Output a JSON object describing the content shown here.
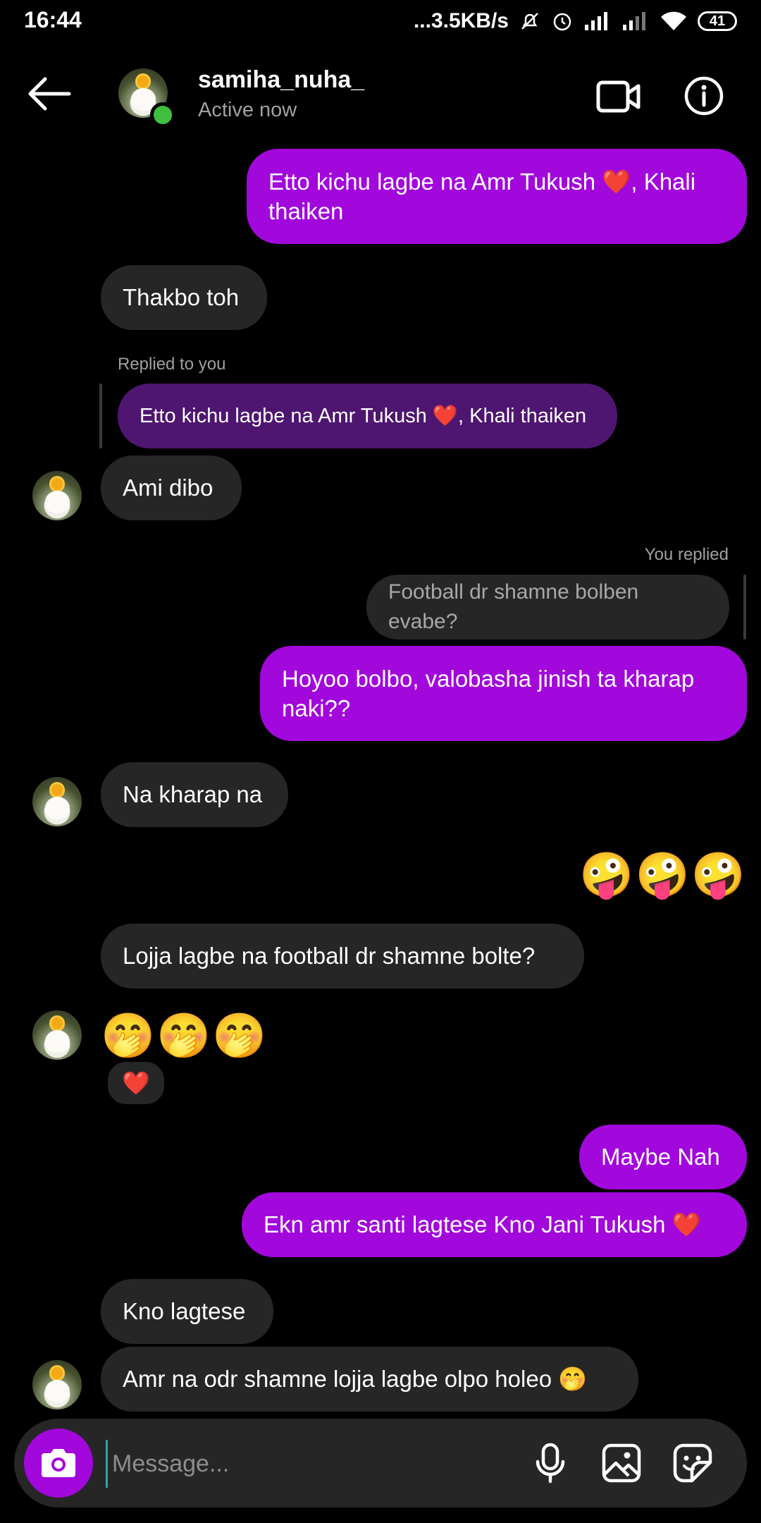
{
  "status_bar": {
    "time": "16:44",
    "speed": "...3.5KB/s",
    "battery": "41"
  },
  "header": {
    "username": "samiha_nuha_",
    "status": "Active now"
  },
  "messages": {
    "m1": "Etto kichu lagbe na Amr Tukush ❤️, Khali thaiken",
    "m2": "Thakbo toh",
    "reply_label_1": "Replied to you",
    "reply_quote_1": "Etto kichu lagbe na Amr Tukush ❤️, Khali thaiken",
    "m3": "Ami dibo",
    "reply_label_2": "You replied",
    "reply_quote_2": "Football dr shamne bolben evabe?",
    "m4": "Hoyoo bolbo, valobasha jinish ta kharap naki??",
    "m5": "Na kharap na",
    "m6": "🤪🤪🤪",
    "m7": "Lojja lagbe na football dr shamne bolte?",
    "m8": "🤭🤭🤭",
    "m8_reaction": "❤️",
    "m9": "Maybe Nah",
    "m10": "Ekn amr santi lagtese Kno Jani Tukush ❤️",
    "m11": "Kno lagtese",
    "m12": "Amr na odr shamne lojja lagbe olpo holeo 🤭"
  },
  "composer": {
    "placeholder": "Message..."
  },
  "colors": {
    "outgoing": "#a207dc",
    "incoming": "#262626",
    "reply_quote": "#4e1670",
    "online": "#3fbf3f"
  },
  "icons": [
    "back-arrow-icon",
    "video-call-icon",
    "info-icon",
    "camera-icon",
    "microphone-icon",
    "gallery-icon",
    "sticker-icon",
    "wifi-icon",
    "signal-icon",
    "alarm-icon",
    "mute-icon"
  ]
}
